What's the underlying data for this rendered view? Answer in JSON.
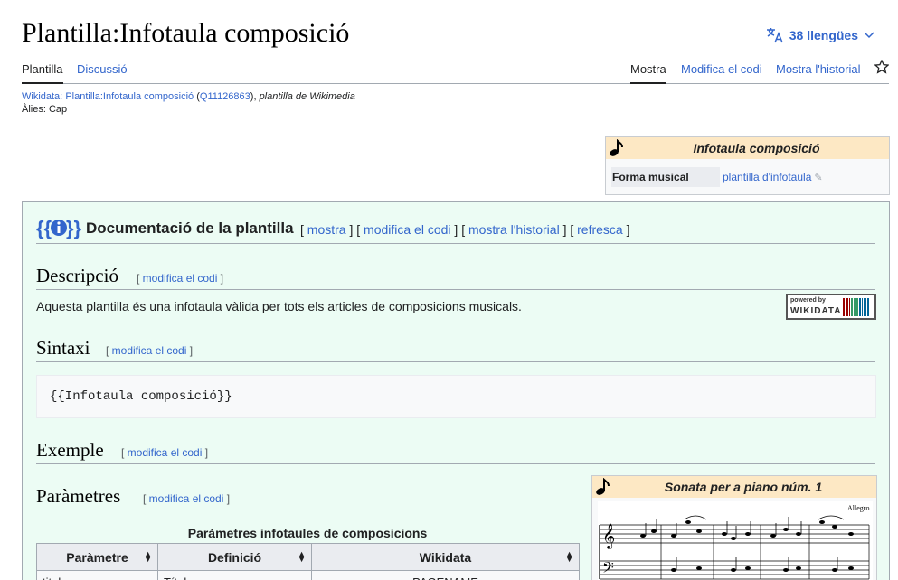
{
  "page": {
    "title": "Plantilla:Infotaula composició",
    "languages_label": "38 llengües"
  },
  "tabs": {
    "template": "Plantilla",
    "talk": "Discussió",
    "read": "Mostra",
    "edit_source": "Modifica el codi",
    "history": "Mostra l'historial"
  },
  "wikidata_line": {
    "prefix": "Wikidata:",
    "item_label": "Plantilla:Infotaula composició",
    "qid": "Q11126863",
    "description": "plantilla de Wikimedia",
    "alias_label": "Àlies:",
    "alias_value": "Cap"
  },
  "infobox": {
    "title": "Infotaula composició",
    "row_label": "Forma musical",
    "row_value": "plantilla d'infotaula",
    "icon": "music-note-icon"
  },
  "doc": {
    "title": "Documentació de la plantilla",
    "links": [
      "mostra",
      "modifica el codi",
      "mostra l'historial",
      "refresca"
    ]
  },
  "sections": {
    "description": {
      "heading": "Descripció",
      "edit": "modifica el codi"
    },
    "syntax": {
      "heading": "Sintaxi",
      "edit": "modifica el codi"
    },
    "example": {
      "heading": "Exemple",
      "edit": "modifica el codi"
    },
    "parameters": {
      "heading": "Paràmetres",
      "edit": "modifica el codi"
    }
  },
  "description_text": "Aquesta plantilla és una infotaula vàlida per tots els articles de composicions musicals.",
  "wikidata_badge": {
    "small": "powered by",
    "big": "WIKIDATA"
  },
  "syntax_code": "{{Infotaula composició}}",
  "param_table": {
    "caption": "Paràmetres infotaules de composicions",
    "headers": [
      "Paràmetre",
      "Definició",
      "Wikidata"
    ],
    "rows": [
      [
        "titol",
        "Títol",
        "PAGENAME"
      ]
    ]
  },
  "sonata_box": {
    "title": "Sonata per a piano núm. 1",
    "score_tempo": "Allegro"
  },
  "colors": {
    "link": "#3366cc",
    "doc_background": "#ecfcf4",
    "infobox_header": "#fde8c4"
  }
}
